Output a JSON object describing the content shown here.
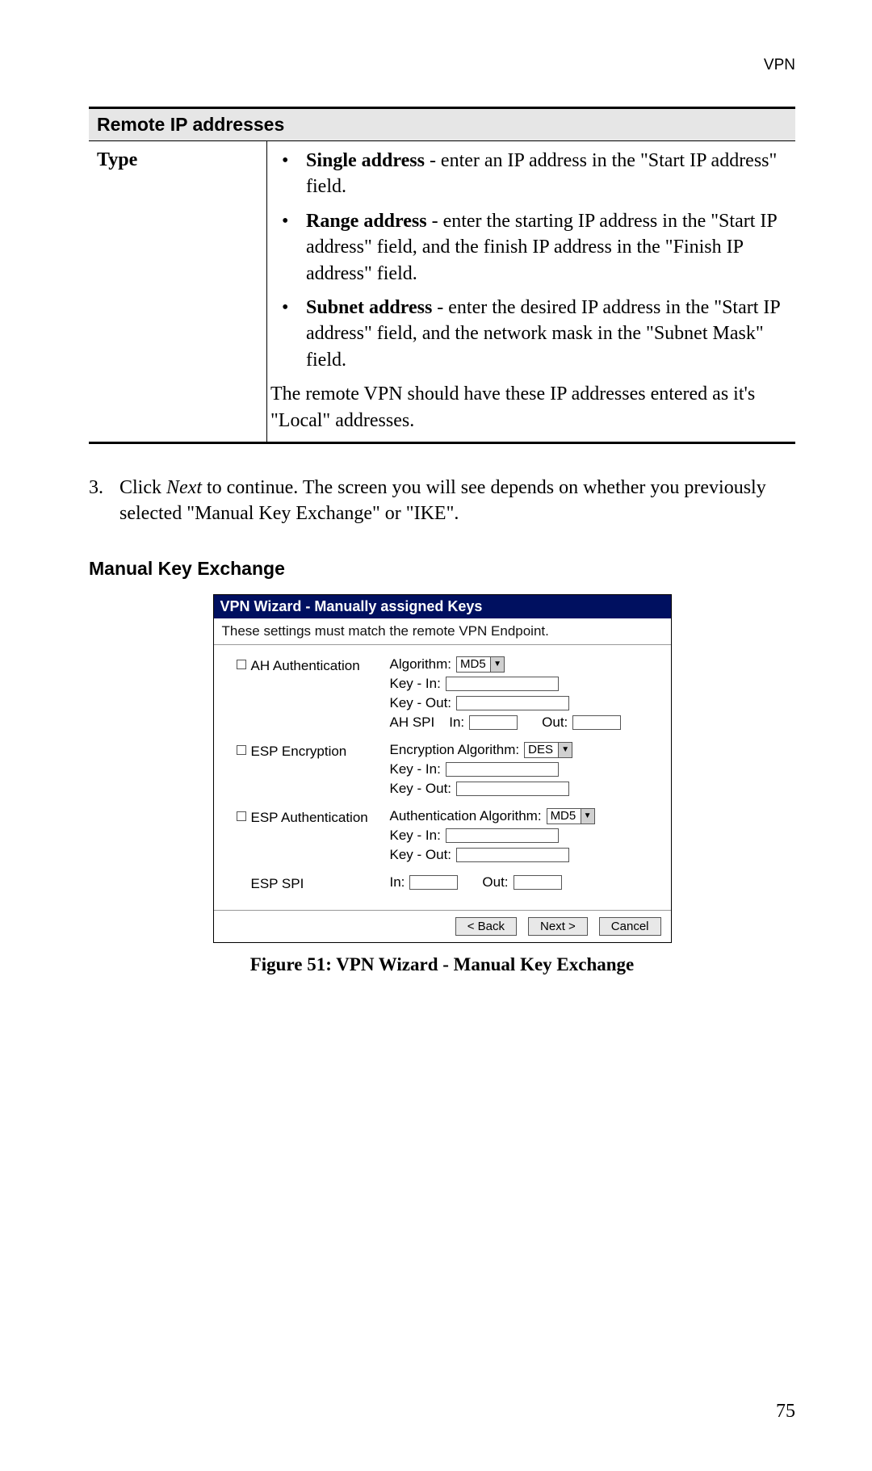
{
  "header": {
    "section": "VPN"
  },
  "table": {
    "header": "Remote IP addresses",
    "row_label": "Type",
    "bullets": [
      {
        "term": "Single address",
        "desc": " - enter an IP address in the \"Start IP address\" field."
      },
      {
        "term": "Range address",
        "desc": " - enter the starting IP address in the \"Start IP address\" field, and the finish IP address in the \"Finish IP address\" field."
      },
      {
        "term": "Subnet address",
        "desc": " - enter the desired IP address in the \"Start IP address\" field, and the network mask in the \"Subnet Mask\" field."
      }
    ],
    "note": "The remote VPN should have these IP addresses entered as it's \"Local\" addresses."
  },
  "step": {
    "number": "3.",
    "pre": "Click ",
    "italic": "Next",
    "post": " to continue. The screen you will see depends on whether you previously selected \"Manual Key Exchange\" or \"IKE\"."
  },
  "section_heading": "Manual Key Exchange",
  "dialog": {
    "title": "VPN Wizard - Manually assigned Keys",
    "subtitle": "These settings must match the remote VPN Endpoint.",
    "ah": {
      "label": "AH Authentication",
      "algorithm_label": "Algorithm:",
      "algorithm_value": "MD5",
      "key_in_label": "Key - In:",
      "key_out_label": "Key - Out:",
      "spi_label": "AH SPI",
      "in_label": "In:",
      "out_label": "Out:"
    },
    "esp_enc": {
      "label": "ESP Encryption",
      "algorithm_label": "Encryption Algorithm:",
      "algorithm_value": "DES",
      "key_in_label": "Key - In:",
      "key_out_label": "Key - Out:"
    },
    "esp_auth": {
      "label": "ESP Authentication",
      "algorithm_label": "Authentication Algorithm:",
      "algorithm_value": "MD5",
      "key_in_label": "Key - In:",
      "key_out_label": "Key - Out:"
    },
    "esp_spi": {
      "label": "ESP SPI",
      "in_label": "In:",
      "out_label": "Out:"
    },
    "buttons": {
      "back": "< Back",
      "next": "Next >",
      "cancel": "Cancel"
    }
  },
  "figure_caption": "Figure 51: VPN Wizard - Manual Key Exchange",
  "page_number": "75"
}
